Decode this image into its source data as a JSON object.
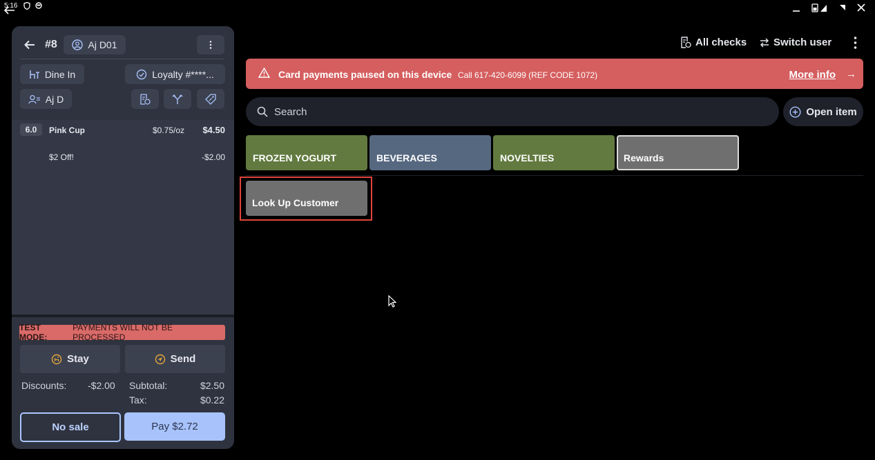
{
  "status_bar": {
    "time": "5:16"
  },
  "order": {
    "number": "#8",
    "employee": "Aj D01",
    "dining_option": "Dine In",
    "loyalty": "Loyalty #****...",
    "customer": "Aj D"
  },
  "line_items": [
    {
      "qty": "6.0",
      "name": "Pink Cup",
      "unit_price": "$0.75/oz",
      "price": "$4.50"
    },
    {
      "name": "$2 Off!",
      "price": "-$2.00"
    }
  ],
  "test_mode": {
    "label": "TEST MODE:",
    "message": "PAYMENTS WILL NOT BE PROCESSED"
  },
  "actions": {
    "stay": "Stay",
    "send": "Send"
  },
  "totals": {
    "discounts_label": "Discounts:",
    "discounts_value": "-$2.00",
    "subtotal_label": "Subtotal:",
    "subtotal_value": "$2.50",
    "tax_label": "Tax:",
    "tax_value": "$0.22"
  },
  "footer": {
    "no_sale": "No sale",
    "pay": "Pay $2.72"
  },
  "top_bar": {
    "all_checks": "All checks",
    "switch_user": "Switch user"
  },
  "alert": {
    "title": "Card payments paused on this device",
    "detail": "Call 617-420-6099 (REF CODE 1072)",
    "link": "More info",
    "arrow": "→"
  },
  "search": {
    "placeholder": "Search"
  },
  "open_item": "Open item",
  "categories": [
    {
      "label": "FROZEN YOGURT",
      "color": "#627a3f"
    },
    {
      "label": "BEVERAGES",
      "color": "#566880"
    },
    {
      "label": "NOVELTIES",
      "color": "#627a3f"
    },
    {
      "label": "Rewards",
      "color": "#6f6f6f"
    }
  ],
  "rewards_items": [
    {
      "label": "Look Up Customer"
    }
  ],
  "colors": {
    "accent": "#a8c3fb",
    "alert": "#d55e5f",
    "test_mode": "#d96a68",
    "highlight": "#e0453a"
  }
}
